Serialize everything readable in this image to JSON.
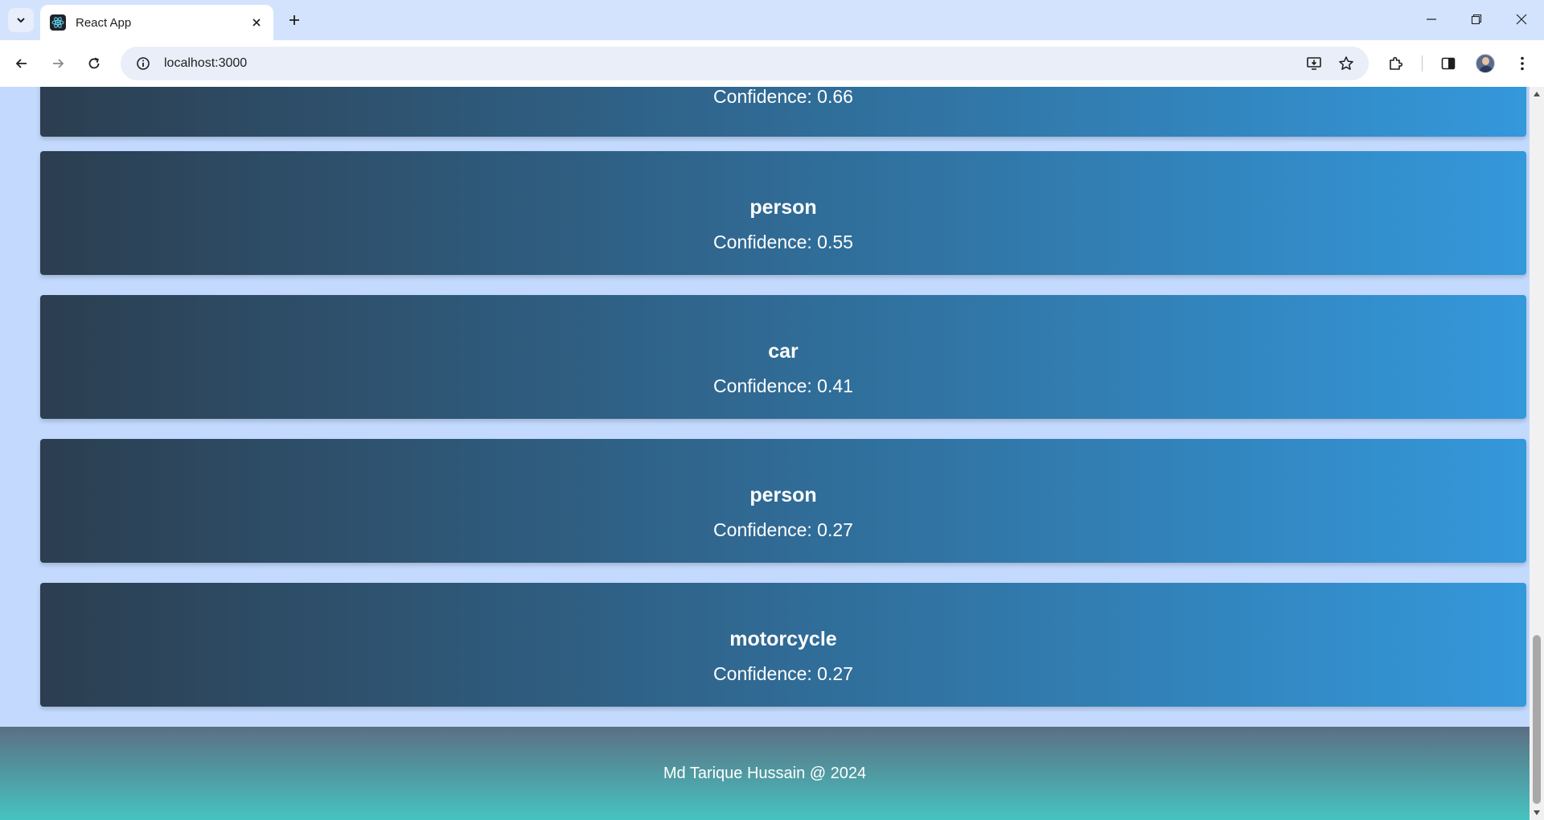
{
  "browser": {
    "tab": {
      "title": "React App",
      "favicon": "react-icon"
    },
    "url": "localhost:3000",
    "icons": {
      "tab_search": "chevron-down-icon",
      "tab_close": "close-icon",
      "new_tab": "plus-icon",
      "back": "arrow-left-icon",
      "forward": "arrow-right-icon",
      "reload": "reload-icon",
      "site_info": "info-icon",
      "install": "install-app-icon",
      "bookmark": "star-icon",
      "extensions": "puzzle-icon",
      "side_panel": "side-panel-icon",
      "menu": "kebab-menu-icon"
    }
  },
  "detections": [
    {
      "label": "",
      "confidence_text": "Confidence: 0.66"
    },
    {
      "label": "person",
      "confidence_text": "Confidence: 0.55"
    },
    {
      "label": "car",
      "confidence_text": "Confidence: 0.41"
    },
    {
      "label": "person",
      "confidence_text": "Confidence: 0.27"
    },
    {
      "label": "motorcycle",
      "confidence_text": "Confidence: 0.27"
    }
  ],
  "footer": {
    "text": "Md Tarique Hussain @ 2024"
  },
  "colors": {
    "card_gradient_start": "#2c3e50",
    "card_gradient_end": "#3498db",
    "page_background": "#c3dafe",
    "footer_gradient_top": "#5b6f83",
    "footer_gradient_bottom": "#46c3c0"
  }
}
